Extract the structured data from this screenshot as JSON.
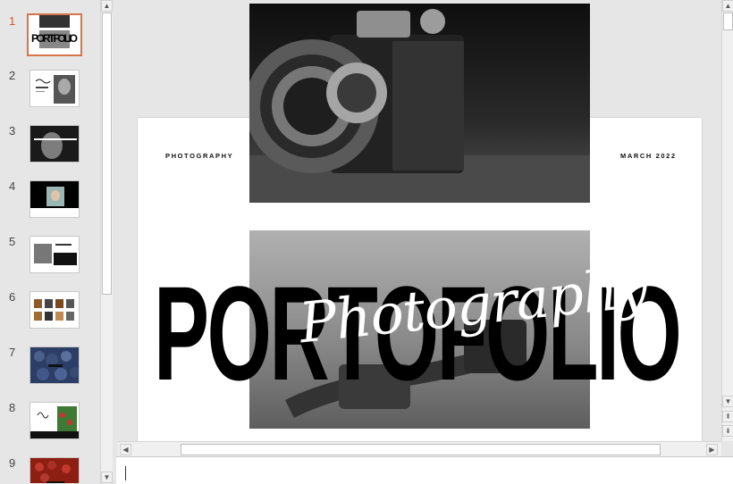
{
  "thumbnails": [
    {
      "number": "1",
      "active": true
    },
    {
      "number": "2",
      "active": false
    },
    {
      "number": "3",
      "active": false
    },
    {
      "number": "4",
      "active": false
    },
    {
      "number": "5",
      "active": false
    },
    {
      "number": "6",
      "active": false
    },
    {
      "number": "7",
      "active": false
    },
    {
      "number": "8",
      "active": false
    },
    {
      "number": "9",
      "active": false
    }
  ],
  "slide": {
    "label_left": "PHOTOGRAPHY",
    "label_right": "MARCH 2022",
    "title": "PORTOFOLIO",
    "script_title": "Photography"
  },
  "colors": {
    "active_accent": "#d9734b",
    "active_number": "#c55a2b"
  }
}
